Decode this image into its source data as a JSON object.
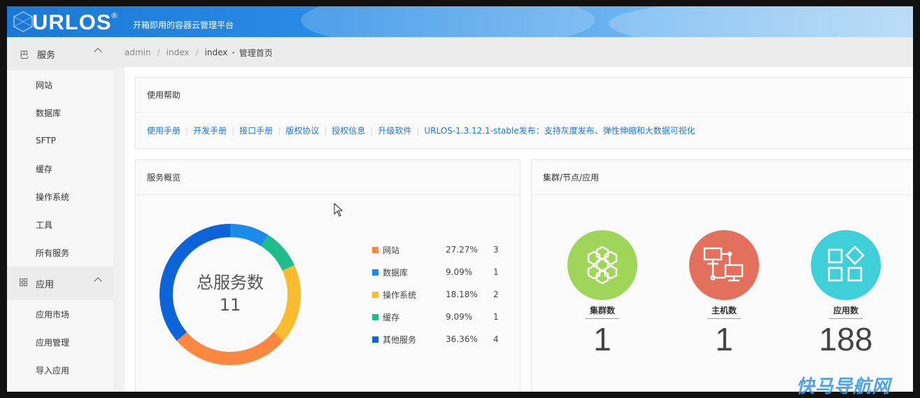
{
  "header": {
    "logo": "URLOS",
    "registered": "®",
    "tagline": "开箱即用的容器云管理平台"
  },
  "sidebar": {
    "groups": [
      {
        "label": "服务",
        "icon": "grid-icon",
        "items": [
          "网站",
          "数据库",
          "SFTP",
          "缓存",
          "操作系统",
          "工具",
          "所有服务"
        ]
      },
      {
        "label": "应用",
        "icon": "apps-icon",
        "items": [
          "应用市场",
          "应用管理",
          "导入应用"
        ]
      }
    ]
  },
  "breadcrumb": {
    "items": [
      "admin",
      "index",
      "index"
    ],
    "dash": "-",
    "current": "管理首页"
  },
  "help": {
    "title": "使用帮助",
    "links": [
      "使用手册",
      "开发手册",
      "接口手册",
      "版权协议",
      "授权信息",
      "升级软件",
      "URLOS-1.3.12.1-stable发布：支持灰度发布、弹性伸缩和大数据可视化"
    ]
  },
  "overview": {
    "title": "服务概览",
    "center_label": "总服务数",
    "center_value": "11",
    "legend": [
      {
        "name": "网站",
        "pct": "27.27%",
        "count": "3",
        "color": "#fb8741"
      },
      {
        "name": "数据库",
        "pct": "9.09%",
        "count": "1",
        "color": "#1a8be6"
      },
      {
        "name": "操作系统",
        "pct": "18.18%",
        "count": "2",
        "color": "#fbbb2f"
      },
      {
        "name": "缓存",
        "pct": "9.09%",
        "count": "1",
        "color": "#1fbc8c"
      },
      {
        "name": "其他服务",
        "pct": "36.36%",
        "count": "4",
        "color": "#0c64d8"
      }
    ]
  },
  "chart_data": {
    "type": "pie",
    "categories": [
      "数据库",
      "缓存",
      "操作系统",
      "网站",
      "其他服务"
    ],
    "values": [
      1,
      1,
      2,
      3,
      4
    ],
    "colors": [
      "#1a8be6",
      "#1fbc8c",
      "#fbbb2f",
      "#fb8741",
      "#0c64d8"
    ],
    "title": "总服务数",
    "total": 11
  },
  "cluster": {
    "title": "集群/节点/应用",
    "stats": [
      {
        "label": "集群数",
        "value": "1",
        "color": "#9fd65a",
        "icon": "hexagon-cluster-icon"
      },
      {
        "label": "主机数",
        "value": "1",
        "color": "#e2705c",
        "icon": "host-network-icon"
      },
      {
        "label": "应用数",
        "value": "188",
        "color": "#3ecfd8",
        "icon": "apps-shapes-icon"
      }
    ]
  },
  "watermark": "快马导航网"
}
